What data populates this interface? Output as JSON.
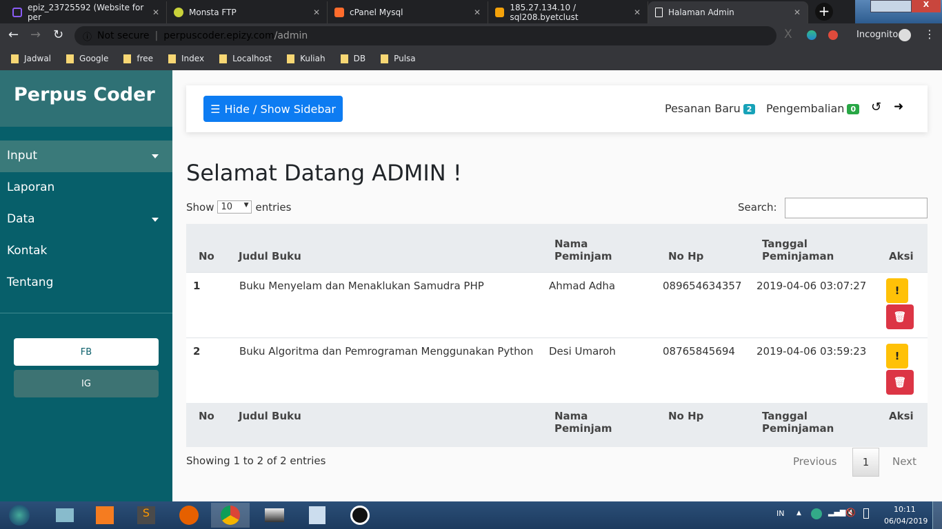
{
  "browser": {
    "tabs": [
      {
        "title": "epiz_23725592 (Website for per",
        "icon": "infinity-icon",
        "color": "#8a5cf6"
      },
      {
        "title": "Monsta FTP",
        "icon": "monsta-icon",
        "color": "#c9d23a"
      },
      {
        "title": "cPanel Mysql",
        "icon": "cpanel-icon",
        "color": "#ff6c2c"
      },
      {
        "title": "185.27.134.10 / sql208.byetclust",
        "icon": "phpmyadmin-icon",
        "color": "#f4a20a"
      },
      {
        "title": "Halaman Admin",
        "icon": "page-icon",
        "color": "#ffffff"
      }
    ],
    "security": "Not secure",
    "url_host": "perpuscoder.epizy.com",
    "url_path": "/admin",
    "incognito": "Incognito",
    "bookmarks": [
      "Jadwal",
      "Google",
      "free",
      "Index",
      "Localhost",
      "Kuliah",
      "DB",
      "Pulsa"
    ]
  },
  "sidebar": {
    "brand": "Perpus Coder",
    "items": [
      {
        "label": "Input",
        "dropdown": true,
        "active": true
      },
      {
        "label": "Laporan"
      },
      {
        "label": "Data",
        "dropdown": true
      },
      {
        "label": "Kontak"
      },
      {
        "label": "Tentang"
      }
    ],
    "social": [
      "FB",
      "IG"
    ]
  },
  "navbar": {
    "toggle_label": "Hide / Show Sidebar",
    "pesanan_label": "Pesanan Baru",
    "pesanan_count": "2",
    "pengembalian_label": "Pengembalian",
    "pengembalian_count": "0"
  },
  "main": {
    "title": "Selamat Datang ADMIN !",
    "show": "Show",
    "entries_value": "10",
    "entries": "entries",
    "search_label": "Search:",
    "columns": [
      "No",
      "Judul Buku",
      "Nama Peminjam",
      "No Hp",
      "Tanggal Peminjaman",
      "Aksi"
    ],
    "rows": [
      {
        "no": "1",
        "judul": "Buku Menyelam dan Menaklukan Samudra PHP",
        "nama": "Ahmad Adha",
        "hp": "089654634357",
        "tanggal": "2019-04-06 03:07:27"
      },
      {
        "no": "2",
        "judul": "Buku Algoritma dan Pemrograman Menggunakan Python",
        "nama": "Desi Umaroh",
        "hp": "08765845694",
        "tanggal": "2019-04-06 03:59:23"
      }
    ],
    "info": "Showing 1 to 2 of 2 entries",
    "prev": "Previous",
    "page": "1",
    "next": "Next"
  },
  "taskbar": {
    "lang": "IN",
    "time": "10:11",
    "date": "06/04/2019"
  }
}
